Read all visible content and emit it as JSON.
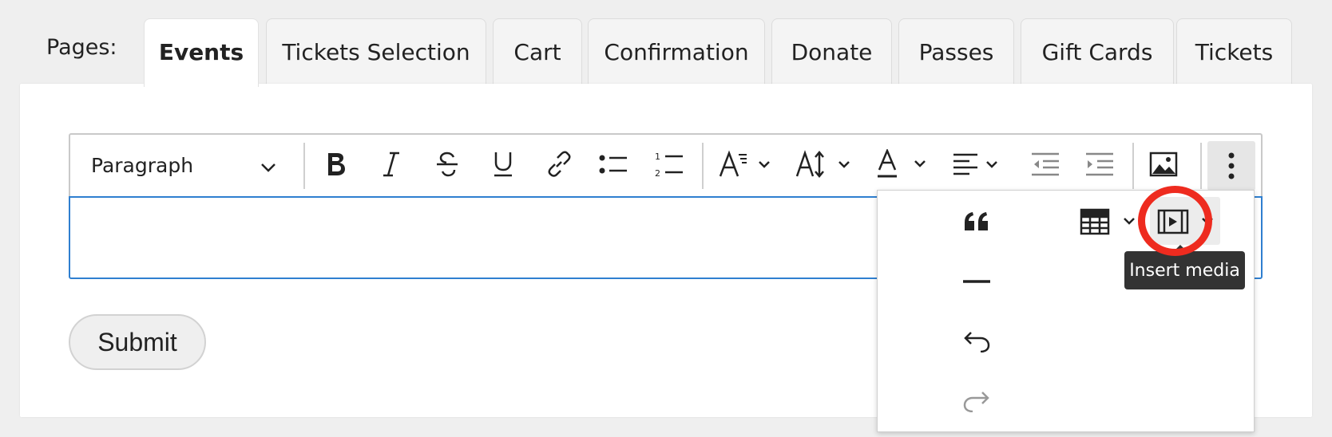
{
  "pages": {
    "label": "Pages:",
    "tabs": [
      {
        "label": "Events",
        "active": true
      },
      {
        "label": "Tickets Selection",
        "active": false
      },
      {
        "label": "Cart",
        "active": false
      },
      {
        "label": "Confirmation",
        "active": false
      },
      {
        "label": "Donate",
        "active": false
      },
      {
        "label": "Passes",
        "active": false
      },
      {
        "label": "Gift Cards",
        "active": false
      },
      {
        "label": "Tickets",
        "active": false
      }
    ]
  },
  "editor": {
    "block_format": "Paragraph",
    "toolbar_buttons": [
      "bold-icon",
      "italic-icon",
      "strikethrough-icon",
      "underline-icon",
      "link-icon",
      "bullet-list-icon",
      "numbered-list-icon",
      "font-family-icon",
      "font-size-icon",
      "text-color-icon",
      "align-icon",
      "outdent-icon",
      "indent-icon",
      "image-icon",
      "more-icon"
    ],
    "overflow_menu": [
      "blockquote-icon",
      "table-icon",
      "media-icon",
      "horizontal-line-icon",
      "undo-icon",
      "redo-icon"
    ],
    "tooltip": "Insert media",
    "accent_color": "#2f7fd0",
    "highlight_color": "#ee2b1f"
  },
  "form": {
    "submit_label": "Submit"
  }
}
